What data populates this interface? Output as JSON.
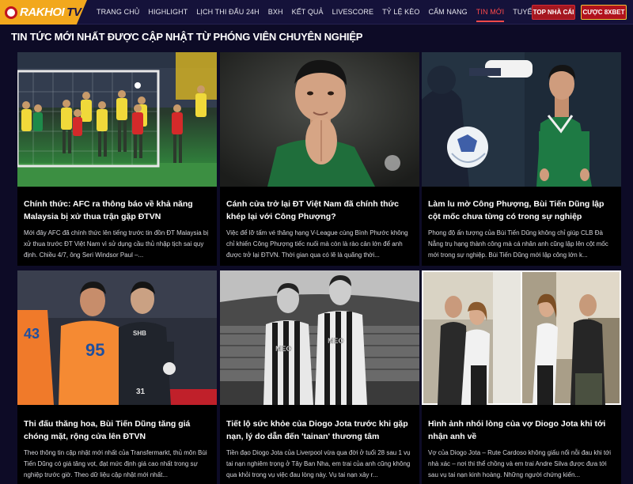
{
  "logo": {
    "main": "RAKHOI",
    "suffix": "TV"
  },
  "nav": {
    "items": [
      {
        "label": "TRANG CHỦ",
        "active": false
      },
      {
        "label": "HIGHLIGHT",
        "active": false
      },
      {
        "label": "LỊCH THI ĐẤU 24H",
        "active": false
      },
      {
        "label": "BXH",
        "active": false
      },
      {
        "label": "KẾT QUẢ",
        "active": false
      },
      {
        "label": "LIVESCORE",
        "active": false
      },
      {
        "label": "TỶ LỆ KÈO",
        "active": false
      },
      {
        "label": "CẨM NANG",
        "active": false
      },
      {
        "label": "TIN MỚI",
        "active": true
      },
      {
        "label": "TUYỂN DỤNG",
        "active": false
      }
    ],
    "top_button": "TOP NHÀ CÁI",
    "bet_button": "CƯỢC 8XBET"
  },
  "section": {
    "title": "TIN TỨC MỚI NHẤT ĐƯỢC CẬP NHẬT TỪ PHÓNG VIÊN CHUYÊN NGHIỆP"
  },
  "articles": [
    {
      "title": "Chính thức: AFC ra thông báo về khả năng Malaysia bị xử thua trận gặp ĐTVN",
      "excerpt": "Mới đây AFC đã chính thức lên tiếng trước tin đồn ĐT Malaysia bị xử thua trước ĐT Việt Nam vì sử dụng cầu thủ nhập tịch sai quy định.  Chiều 4/7, ông Seri Windsor Paul –..."
    },
    {
      "title": "Cánh cửa trở lại ĐT Việt Nam đã chính thức khép lại với Công Phượng?",
      "excerpt": "Việc để lỡ tấm vé thăng hạng V-League cùng Bình Phước không chỉ khiến Công Phượng tiếc nuối mà còn là rào cản lớn để anh được trở lại ĐTVN.  Thời gian qua có lẽ là quãng thời..."
    },
    {
      "title": "Làm lu mờ Công Phượng, Bùi Tiến Dũng lập cột mốc chưa từng có trong sự nghiệp",
      "excerpt": "Phong độ ấn tượng của Bùi Tiến Dũng không chỉ giúp CLB Đà Nẵng trụ hạng thành công mà cá nhân anh cũng lập lên cột mốc mới trong sự nghiệp.  Bùi Tiến Dũng mới lập công lớn k..."
    },
    {
      "title": "Thi đấu thăng hoa, Bùi Tiến Dũng tăng giá chóng mặt, rộng cửa lên ĐTVN",
      "excerpt": "Theo thông tin cập nhật mới nhất của Transfermarkt, thủ môn Bùi Tiến Dũng có giá tăng vọt, đạt mức định giá cao nhất trong sự nghiệp trước giờ.  Theo dữ liệu cập nhật mới nhất..."
    },
    {
      "title": "Tiết lộ sức khỏe của Diogo Jota trước khi gặp nạn, lý do dẫn đến 'tainan' thương tâm",
      "excerpt": "Tiền đạo Diogo Jota của Liverpool vừa qua đời ở tuổi 28 sau 1 vụ tai nạn nghiêm trọng ở Tây Ban Nha, em trai của anh cũng không qua khỏi trong vụ việc đau lòng này.  Vụ tai nạn xảy r..."
    },
    {
      "title": "Hình ảnh nhói lòng của vợ Diogo Jota khi tới nhận anh về",
      "excerpt": "Vợ của Diogo Jota – Rute Cardoso không giấu nổi nỗi đau khi tới nhà xác – nơi thi thể chồng và em trai Andre Silva được đưa tới sau vụ tai nạn kinh hoàng.  Những người chứng kiến..."
    }
  ],
  "image_text": {
    "jersey_95": "95",
    "jersey_43": "43",
    "jersey_31": "31",
    "sponsor_shb": "SHB",
    "sponsor_meo": "MEO"
  },
  "colors": {
    "background": "#0d0b26",
    "nav_background": "#15123a",
    "logo": "#f2a81d",
    "active_nav": "#ff4a4a",
    "button_red": "#b1121c"
  }
}
